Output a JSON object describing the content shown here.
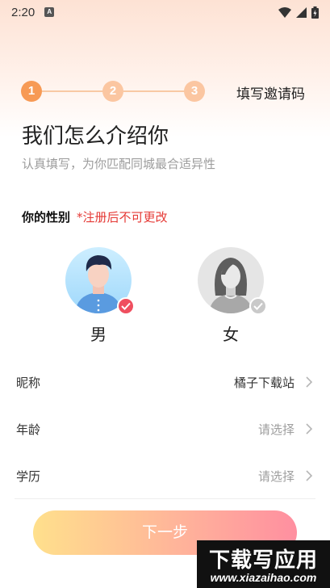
{
  "status_bar": {
    "time": "2:20",
    "notification_badge": "A"
  },
  "steps": {
    "items": [
      {
        "number": "1",
        "state": "active"
      },
      {
        "number": "2",
        "state": "idle"
      },
      {
        "number": "3",
        "state": "idle"
      }
    ],
    "invite_label": "填写邀请码"
  },
  "header": {
    "title": "我们怎么介绍你",
    "subtitle": "认真填写，为你匹配同城最合适异性"
  },
  "gender": {
    "label": "你的性别",
    "note": "*注册后不可更改",
    "options": [
      {
        "label": "男",
        "selected": true
      },
      {
        "label": "女",
        "selected": false
      }
    ]
  },
  "form": {
    "rows": [
      {
        "label": "昵称",
        "value": "橘子下载站",
        "is_placeholder": false
      },
      {
        "label": "年龄",
        "value": "请选择",
        "is_placeholder": true
      },
      {
        "label": "学历",
        "value": "请选择",
        "is_placeholder": true
      }
    ]
  },
  "next_button": {
    "label": "下一步"
  },
  "watermark": {
    "title": "下载写应用",
    "url": "www.xiazaihao.com"
  },
  "colors": {
    "accent": "#f79a55",
    "warning": "#e53935",
    "selected_check": "#ef4f5f"
  }
}
